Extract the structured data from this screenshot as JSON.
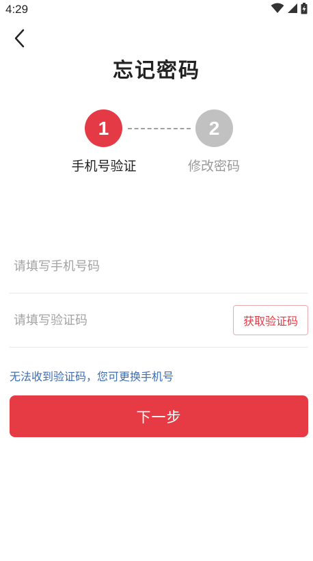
{
  "status_bar": {
    "time": "4:29"
  },
  "header": {
    "title": "忘记密码"
  },
  "steps": [
    {
      "number": "1",
      "label": "手机号验证",
      "state": "active"
    },
    {
      "number": "2",
      "label": "修改密码",
      "state": "inactive"
    }
  ],
  "form": {
    "phone": {
      "value": "",
      "placeholder": "请填写手机号码"
    },
    "code": {
      "value": "",
      "placeholder": "请填写验证码"
    },
    "get_code_label": "获取验证码"
  },
  "change_phone_link": "无法收到验证码，您可更换手机号",
  "next_button_label": "下一步",
  "colors": {
    "accent": "#e43a45",
    "inactive_step": "#c1c1c1",
    "link": "#3d6db5",
    "placeholder": "#a3a3a3"
  },
  "icons": [
    "wifi-icon",
    "signal-icon",
    "battery-icon",
    "back-arrow-icon"
  ]
}
